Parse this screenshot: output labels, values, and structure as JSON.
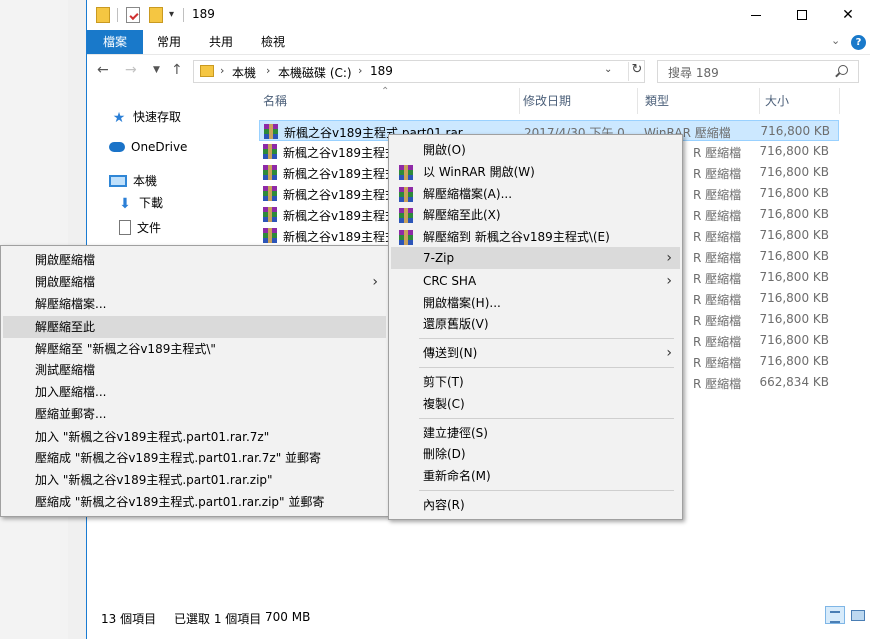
{
  "window": {
    "title": "189"
  },
  "ribbon": {
    "tabs": [
      "檔案",
      "常用",
      "共用",
      "檢視"
    ]
  },
  "address": {
    "crumbs": [
      "本機",
      "本機磁碟 (C:)",
      "189"
    ],
    "search_placeholder": "搜尋 189"
  },
  "nav_pane": {
    "quick_access": "快速存取",
    "onedrive": "OneDrive",
    "this_pc": "本機",
    "downloads": "下載",
    "documents": "文件"
  },
  "columns": {
    "name": "名稱",
    "date": "修改日期",
    "type": "類型",
    "size": "大小"
  },
  "files": [
    {
      "name": "新楓之谷v189主程式.part01.rar",
      "date": "2017/4/30 下午 0",
      "type": "WinRAR 壓縮檔",
      "size": "716,800 KB"
    },
    {
      "name": "新楓之谷v189主程式",
      "type": "R 壓縮檔",
      "size": "716,800 KB"
    },
    {
      "name": "新楓之谷v189主程式",
      "type": "R 壓縮檔",
      "size": "716,800 KB"
    },
    {
      "name": "新楓之谷v189主程式",
      "type": "R 壓縮檔",
      "size": "716,800 KB"
    },
    {
      "name": "新楓之谷v189主程式",
      "type": "R 壓縮檔",
      "size": "716,800 KB"
    },
    {
      "name": "新楓之谷v189主程式",
      "type": "R 壓縮檔",
      "size": "716,800 KB"
    },
    {
      "type": "R 壓縮檔",
      "size": "716,800 KB"
    },
    {
      "type": "R 壓縮檔",
      "size": "716,800 KB"
    },
    {
      "type": "R 壓縮檔",
      "size": "716,800 KB"
    },
    {
      "type": "R 壓縮檔",
      "size": "716,800 KB"
    },
    {
      "type": "R 壓縮檔",
      "size": "716,800 KB"
    },
    {
      "type": "R 壓縮檔",
      "size": "716,800 KB"
    },
    {
      "type": "R 壓縮檔",
      "size": "662,834 KB"
    }
  ],
  "status": {
    "count": "13 個項目",
    "selected": "已選取 1 個項目",
    "size": "700 MB"
  },
  "context_menu": {
    "items": [
      "開啟(O)",
      "以 WinRAR 開啟(W)",
      "解壓縮檔案(A)...",
      "解壓縮至此(X)",
      "解壓縮到 新楓之谷v189主程式\\(E)",
      "7-Zip",
      "CRC SHA",
      "開啟檔案(H)...",
      "還原舊版(V)",
      "傳送到(N)",
      "剪下(T)",
      "複製(C)",
      "建立捷徑(S)",
      "刪除(D)",
      "重新命名(M)",
      "內容(R)"
    ]
  },
  "sevenzip_menu": {
    "items": [
      "開啟壓縮檔",
      "開啟壓縮檔",
      "解壓縮檔案...",
      "解壓縮至此",
      "解壓縮至 \"新楓之谷v189主程式\\\"",
      "測試壓縮檔",
      "加入壓縮檔...",
      "壓縮並郵寄...",
      "加入 \"新楓之谷v189主程式.part01.rar.7z\"",
      "壓縮成 \"新楓之谷v189主程式.part01.rar.7z\" 並郵寄",
      "加入 \"新楓之谷v189主程式.part01.rar.zip\"",
      "壓縮成 \"新楓之谷v189主程式.part01.rar.zip\" 並郵寄"
    ]
  },
  "colors": {
    "accent": "#1979ca",
    "selection": "#cce8ff",
    "menu_highlight": "#dadada"
  }
}
